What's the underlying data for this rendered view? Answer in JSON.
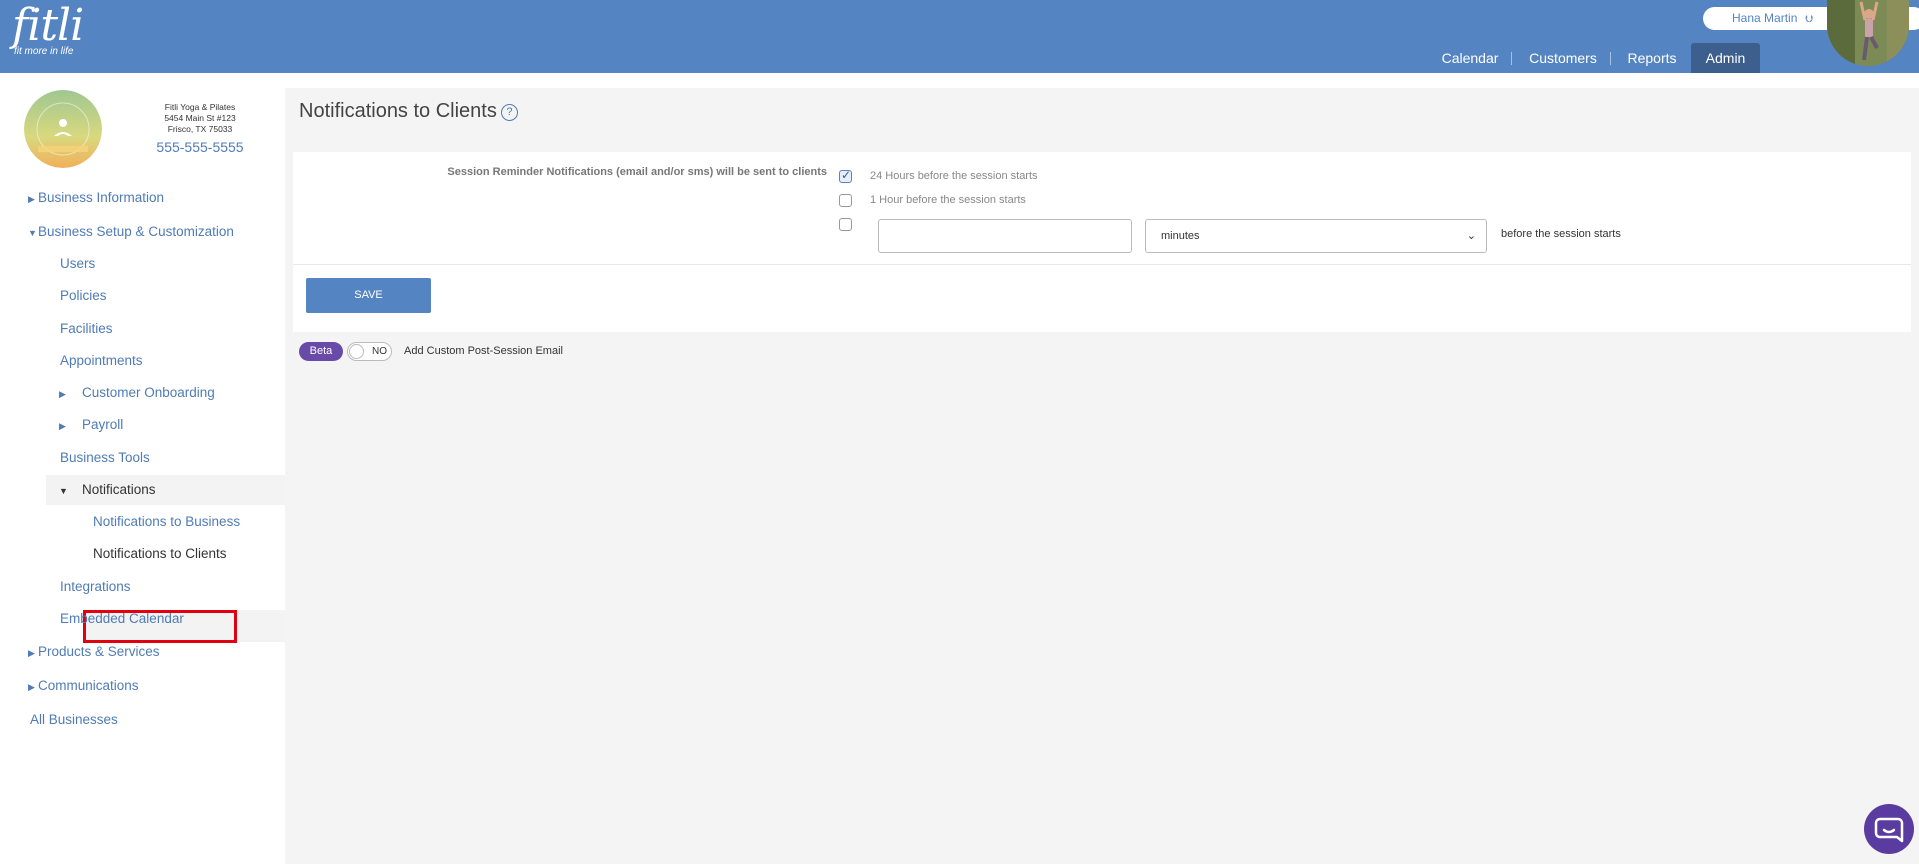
{
  "app": {
    "logo_text": "fitli",
    "logo_tagline": "fit more in life"
  },
  "header": {
    "user_name": "Hana Martin",
    "nav": [
      {
        "label": "Calendar"
      },
      {
        "label": "Customers"
      },
      {
        "label": "Reports"
      },
      {
        "label": "Admin",
        "active": true
      }
    ]
  },
  "business": {
    "name": "Fitli Yoga & Pilates",
    "address_line1": "5454 Main St #123",
    "address_line2": "Frisco, TX 75033",
    "phone": "555-555-5555"
  },
  "sidebar": {
    "business_information": "Business Information",
    "business_setup": "Business Setup & Customization",
    "users": "Users",
    "policies": "Policies",
    "facilities": "Facilities",
    "appointments": "Appointments",
    "customer_onboarding": "Customer Onboarding",
    "payroll": "Payroll",
    "business_tools": "Business Tools",
    "notifications": "Notifications",
    "notifications_to_business": "Notifications to Business",
    "notifications_to_clients": "Notifications to Clients",
    "integrations": "Integrations",
    "embedded_calendar": "Embedded Calendar",
    "products_services": "Products & Services",
    "communications": "Communications",
    "all_businesses": "All Businesses"
  },
  "main": {
    "title": "Notifications to Clients",
    "help_glyph": "?",
    "reminder_label": "Session Reminder Notifications (email and/or sms) will be sent to clients",
    "options": [
      {
        "label": "24 Hours before the session starts",
        "checked": true
      },
      {
        "label": "1 Hour before the session starts",
        "checked": false
      },
      {
        "label": "",
        "checked": false
      }
    ],
    "custom_value": "",
    "unit_selected": "minutes",
    "before_label": "before the session starts",
    "save_label": "SAVE",
    "beta_label": "Beta",
    "toggle_text": "NO",
    "post_session_label": "Add Custom Post-Session Email"
  },
  "colors": {
    "header_bg": "#5584c2",
    "link": "#4f7bb6",
    "highlight_box": "#e0000e",
    "beta": "#6a4aa8",
    "chat": "#5a3ca0"
  }
}
